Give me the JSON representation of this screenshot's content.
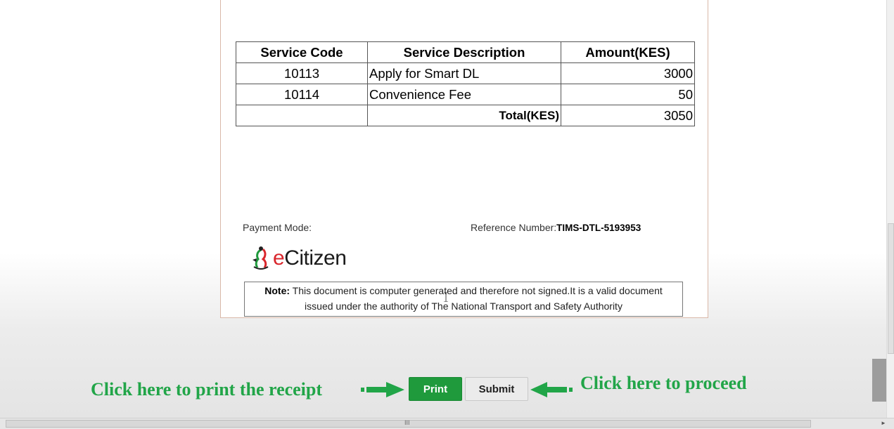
{
  "fees_table": {
    "headers": [
      "Service Code",
      "Service Description",
      "Amount(KES)"
    ],
    "rows": [
      {
        "code": "10113",
        "description": "Apply for Smart DL",
        "amount": "3000"
      },
      {
        "code": "10114",
        "description": "Convenience Fee",
        "amount": "50"
      }
    ],
    "total_label": "Total(KES)",
    "total_amount": "3050"
  },
  "payment": {
    "mode_label": "Payment Mode:",
    "reference_label": "Reference Number:",
    "reference_value": "TIMS-DTL-5193953"
  },
  "logo": {
    "prefix": "e",
    "name": "Citizen"
  },
  "note": {
    "label": "Note:",
    "line1": " This document is computer generated and therefore not signed.It is a valid document",
    "line2": "issued under the authority of The National Transport and Safety Authority"
  },
  "actions": {
    "hint_print": "Click here to print the receipt",
    "hint_proceed": "Click here to proceed",
    "print_label": "Print",
    "submit_label": "Submit"
  },
  "colors": {
    "hint_green": "#21a548",
    "print_button": "#1f9a3c",
    "logo_red": "#d9262c"
  },
  "icons": {
    "cursor": "text-cursor-icon",
    "arrow_right": "arrow-right-icon",
    "arrow_left": "arrow-left-icon",
    "scroll_grip": "scroll-grip-icon",
    "scroll_arrow": "scroll-right-arrow-icon"
  },
  "scroll_glyphs": {
    "grip": "III",
    "arrow": "►"
  }
}
